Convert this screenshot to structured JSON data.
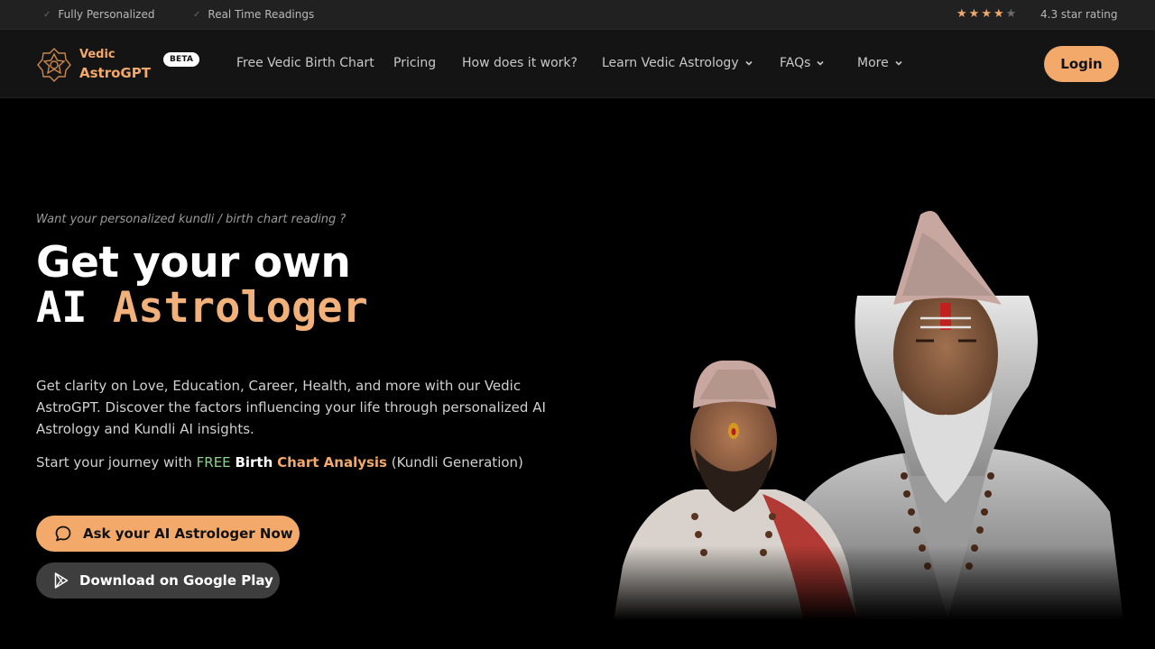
{
  "topbar": {
    "features": [
      "Fully Personalized",
      "Real Time Readings"
    ],
    "rating_value": 4.3,
    "rating_text": "4.3 star rating",
    "stars_total": 5
  },
  "nav": {
    "brand_line1": "Vedic",
    "brand_line2": "AstroGPT",
    "badge": "BETA",
    "links": [
      "Free Vedic Birth Chart",
      "Pricing",
      "How does it work?",
      "Learn Vedic Astrology",
      "FAQs",
      "More"
    ],
    "login": "Login"
  },
  "hero": {
    "tagline": "Want your personalized kundli / birth chart reading ?",
    "title_line1": "Get your own",
    "title_ai": "AI",
    "title_astrologer": "Astrologer",
    "description": "Get clarity on Love, Education, Career, Health, and more with our Vedic AstroGPT. Discover the factors influencing your life through personalized AI Astrology and Kundli AI insights.",
    "journey_prefix": "Start your journey with",
    "journey_free": "FREE",
    "journey_birth": "Birth",
    "journey_chart": "Chart Analysis",
    "journey_suffix": "(Kundli Generation)",
    "cta_primary": "Ask your AI Astrologer Now",
    "cta_secondary": "Download on Google Play"
  },
  "colors": {
    "accent": "#f2a96a",
    "free_green": "#8fd18f",
    "background": "#000000",
    "nav_bg": "#141414"
  },
  "icons": [
    "check-icon",
    "star-icon",
    "astro-logo-icon",
    "chevron-down-icon",
    "chat-bubble-icon",
    "google-play-icon"
  ]
}
